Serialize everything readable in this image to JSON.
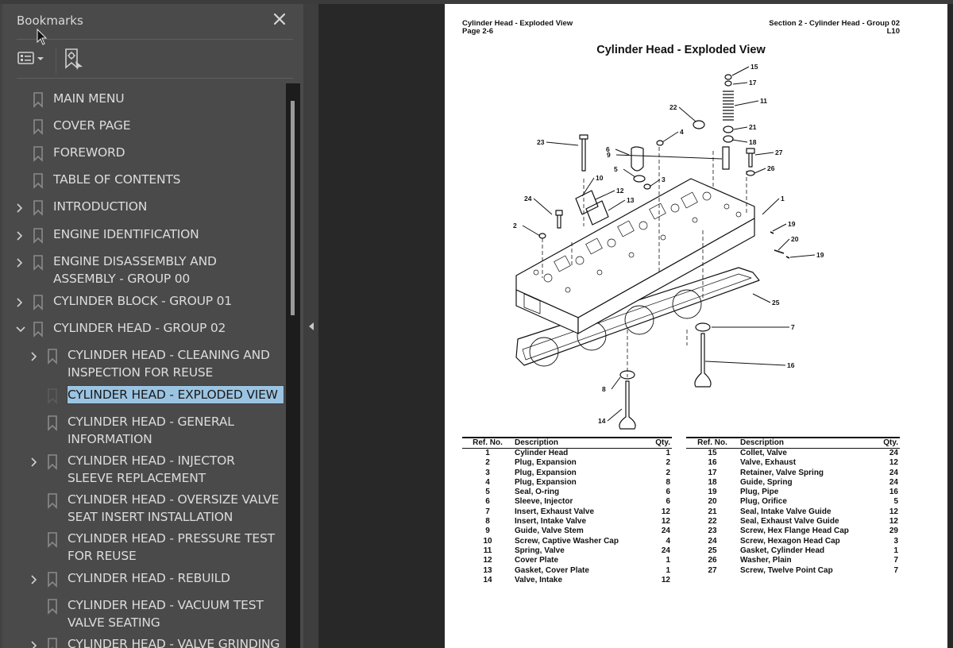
{
  "bookmarks_panel": {
    "title": "Bookmarks",
    "close_icon": "close-icon",
    "toolbar": {
      "options_icon": "list-options-icon",
      "dropdown_icon": "caret-down-icon",
      "find_current_icon": "find-current-bookmark-icon"
    },
    "items": [
      {
        "label": "MAIN MENU",
        "level": 0,
        "expandable": false,
        "expanded": false,
        "selected": false
      },
      {
        "label": "COVER PAGE",
        "level": 0,
        "expandable": false,
        "expanded": false,
        "selected": false
      },
      {
        "label": "FOREWORD",
        "level": 0,
        "expandable": false,
        "expanded": false,
        "selected": false
      },
      {
        "label": "TABLE OF CONTENTS",
        "level": 0,
        "expandable": false,
        "expanded": false,
        "selected": false
      },
      {
        "label": "INTRODUCTION",
        "level": 0,
        "expandable": true,
        "expanded": false,
        "selected": false
      },
      {
        "label": "ENGINE IDENTIFICATION",
        "level": 0,
        "expandable": true,
        "expanded": false,
        "selected": false
      },
      {
        "label": "ENGINE DISASSEMBLY AND ASSEMBLY - GROUP 00",
        "level": 0,
        "expandable": true,
        "expanded": false,
        "selected": false
      },
      {
        "label": "CYLINDER BLOCK - GROUP 01",
        "level": 0,
        "expandable": true,
        "expanded": false,
        "selected": false
      },
      {
        "label": "CYLINDER HEAD - GROUP 02",
        "level": 0,
        "expandable": true,
        "expanded": true,
        "selected": false
      },
      {
        "label": "CYLINDER HEAD - CLEANING AND INSPECTION FOR REUSE",
        "level": 1,
        "expandable": true,
        "expanded": false,
        "selected": false
      },
      {
        "label": "CYLINDER HEAD - EXPLODED VIEW",
        "level": 1,
        "expandable": false,
        "expanded": false,
        "selected": true
      },
      {
        "label": "CYLINDER HEAD - GENERAL INFORMATION",
        "level": 1,
        "expandable": false,
        "expanded": false,
        "selected": false
      },
      {
        "label": "CYLINDER HEAD - INJECTOR SLEEVE REPLACEMENT",
        "level": 1,
        "expandable": true,
        "expanded": false,
        "selected": false
      },
      {
        "label": "CYLINDER HEAD - OVERSIZE VALVE SEAT INSERT INSTALLATION",
        "level": 1,
        "expandable": false,
        "expanded": false,
        "selected": false
      },
      {
        "label": "CYLINDER HEAD - PRESSURE TEST FOR REUSE",
        "level": 1,
        "expandable": false,
        "expanded": false,
        "selected": false
      },
      {
        "label": "CYLINDER HEAD - REBUILD",
        "level": 1,
        "expandable": true,
        "expanded": false,
        "selected": false
      },
      {
        "label": "CYLINDER HEAD - VACUUM TEST VALVE SEATING",
        "level": 1,
        "expandable": false,
        "expanded": false,
        "selected": false
      },
      {
        "label": "CYLINDER HEAD - VALVE GRINDING",
        "level": 1,
        "expandable": true,
        "expanded": false,
        "selected": false
      }
    ],
    "colors": {
      "panel_bg": "#4a4a4a",
      "text": "#dcdcdc",
      "selection_bg": "#9bc4e2"
    }
  },
  "splitter": {
    "collapse_icon": "collapse-left-icon"
  },
  "document": {
    "header_left": [
      "Cylinder Head - Exploded View",
      "Page 2-6"
    ],
    "header_right": [
      "Section 2 - Cylinder Head - Group 02",
      "L10"
    ],
    "title": "Cylinder Head - Exploded View",
    "diagram_callouts": [
      "1",
      "2",
      "3",
      "4",
      "5",
      "6",
      "9",
      "10",
      "11",
      "12",
      "13",
      "15",
      "17",
      "18",
      "19",
      "20",
      "19",
      "21",
      "22",
      "23",
      "24",
      "25",
      "26",
      "27",
      "7",
      "16",
      "8",
      "14"
    ],
    "table_headers": {
      "ref": "Ref. No.",
      "desc": "Description",
      "qty": "Qty."
    },
    "parts_left": [
      {
        "ref": "1",
        "desc": "Cylinder Head",
        "qty": "1"
      },
      {
        "ref": "2",
        "desc": "Plug, Expansion",
        "qty": "2"
      },
      {
        "ref": "3",
        "desc": "Plug, Expansion",
        "qty": "2"
      },
      {
        "ref": "4",
        "desc": "Plug, Expansion",
        "qty": "8"
      },
      {
        "ref": "5",
        "desc": "Seal, O-ring",
        "qty": "6"
      },
      {
        "ref": "6",
        "desc": "Sleeve, Injector",
        "qty": "6"
      },
      {
        "ref": "7",
        "desc": "Insert, Exhaust Valve",
        "qty": "12"
      },
      {
        "ref": "8",
        "desc": "Insert, Intake Valve",
        "qty": "12"
      },
      {
        "ref": "9",
        "desc": "Guide, Valve Stem",
        "qty": "24"
      },
      {
        "ref": "10",
        "desc": "Screw, Captive Washer Cap",
        "qty": "4"
      },
      {
        "ref": "11",
        "desc": "Spring, Valve",
        "qty": "24"
      },
      {
        "ref": "12",
        "desc": "Cover Plate",
        "qty": "1"
      },
      {
        "ref": "13",
        "desc": "Gasket, Cover Plate",
        "qty": "1"
      },
      {
        "ref": "14",
        "desc": "Valve, Intake",
        "qty": "12"
      }
    ],
    "parts_right": [
      {
        "ref": "15",
        "desc": "Collet, Valve",
        "qty": "24"
      },
      {
        "ref": "16",
        "desc": "Valve, Exhaust",
        "qty": "12"
      },
      {
        "ref": "17",
        "desc": "Retainer, Valve Spring",
        "qty": "24"
      },
      {
        "ref": "18",
        "desc": "Guide, Spring",
        "qty": "24"
      },
      {
        "ref": "19",
        "desc": "Plug, Pipe",
        "qty": "16"
      },
      {
        "ref": "20",
        "desc": "Plug, Orifice",
        "qty": "5"
      },
      {
        "ref": "21",
        "desc": "Seal, Intake Valve Guide",
        "qty": "12"
      },
      {
        "ref": "22",
        "desc": "Seal, Exhaust Valve Guide",
        "qty": "12"
      },
      {
        "ref": "23",
        "desc": "Screw, Hex Flange Head Cap",
        "qty": "29"
      },
      {
        "ref": "24",
        "desc": "Screw, Hexagon Head Cap",
        "qty": "3"
      },
      {
        "ref": "25",
        "desc": "Gasket, Cylinder Head",
        "qty": "1"
      },
      {
        "ref": "26",
        "desc": "Washer, Plain",
        "qty": "7"
      },
      {
        "ref": "27",
        "desc": "Screw, Twelve Point Cap",
        "qty": "7"
      }
    ]
  }
}
